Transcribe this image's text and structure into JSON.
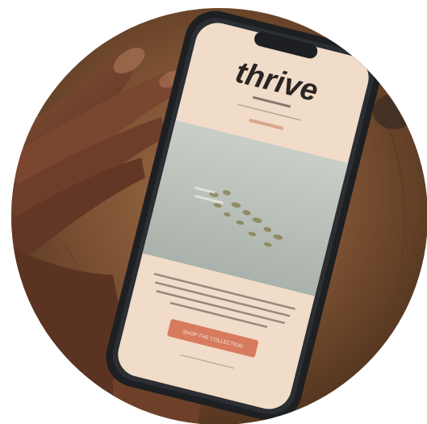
{
  "photo": {
    "subject": "hand-holding-phone-on-wooden-table",
    "colors": {
      "wood_dark": "#5a3a22",
      "wood_mid": "#8b5e3c",
      "wood_light": "#a9774f",
      "skin": "#6b3f2a",
      "skin_highlight": "#8a5439",
      "phone_frame": "#1d1f22",
      "screen_top_bg": "#f1dcc9",
      "screen_image_bg": "#b7bdb6",
      "screen_bottom_bg": "#efd9c6",
      "cta_button": "#d77b5e",
      "text_dark": "#2a2522"
    }
  },
  "screen": {
    "brand_title": "thrive",
    "cta_label": "SHOP THE COLLECTION"
  }
}
